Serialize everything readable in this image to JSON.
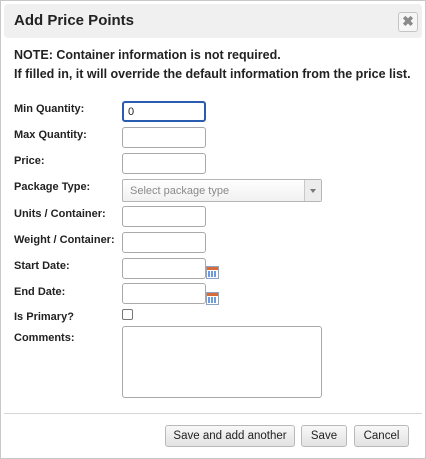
{
  "dialog": {
    "title": "Add Price Points",
    "close_icon": "close-icon",
    "close_glyph": "✖"
  },
  "note": {
    "line1": "NOTE: Container information is not required.",
    "line2": "If filled in, it will override the default information from the price list."
  },
  "fields": {
    "min_quantity": {
      "label": "Min Quantity:",
      "value": "0"
    },
    "max_quantity": {
      "label": "Max Quantity:",
      "value": ""
    },
    "price": {
      "label": "Price:",
      "value": ""
    },
    "package_type": {
      "label": "Package Type:",
      "placeholder": "Select package type"
    },
    "units_container": {
      "label": "Units / Container:",
      "value": ""
    },
    "weight_container": {
      "label": "Weight / Container:",
      "value": ""
    },
    "start_date": {
      "label": "Start Date:",
      "value": ""
    },
    "end_date": {
      "label": "End Date:",
      "value": ""
    },
    "is_primary": {
      "label": "Is Primary?",
      "checked": false
    },
    "comments": {
      "label": "Comments:",
      "value": ""
    }
  },
  "buttons": {
    "save_add_another": "Save and add another",
    "save": "Save",
    "cancel": "Cancel"
  },
  "icons": {
    "calendar": "calendar-icon",
    "dropdown": "chevron-down-icon"
  },
  "colors": {
    "focus_border": "#2a5db0",
    "titlebar_bg": "#f0f0f0"
  }
}
